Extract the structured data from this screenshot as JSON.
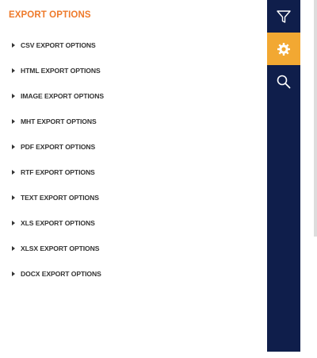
{
  "panel": {
    "title": "EXPORT OPTIONS",
    "options": [
      {
        "label": "CSV EXPORT OPTIONS"
      },
      {
        "label": "HTML EXPORT OPTIONS"
      },
      {
        "label": "IMAGE EXPORT OPTIONS"
      },
      {
        "label": "MHT EXPORT OPTIONS"
      },
      {
        "label": "PDF EXPORT OPTIONS"
      },
      {
        "label": "RTF EXPORT OPTIONS"
      },
      {
        "label": "TEXT EXPORT OPTIONS"
      },
      {
        "label": "XLS EXPORT OPTIONS"
      },
      {
        "label": "XLSX EXPORT OPTIONS"
      },
      {
        "label": "DOCX EXPORT OPTIONS"
      }
    ]
  },
  "toolbar": {
    "buttons": [
      {
        "icon": "filter-icon",
        "active": false
      },
      {
        "icon": "gear-icon",
        "active": true
      },
      {
        "icon": "search-icon",
        "active": false
      }
    ]
  },
  "colors": {
    "title": "#ee7a2b",
    "toolbar_bg": "#0f1e4b",
    "active_tool_bg": "#f2a832",
    "option_text": "#333333"
  }
}
